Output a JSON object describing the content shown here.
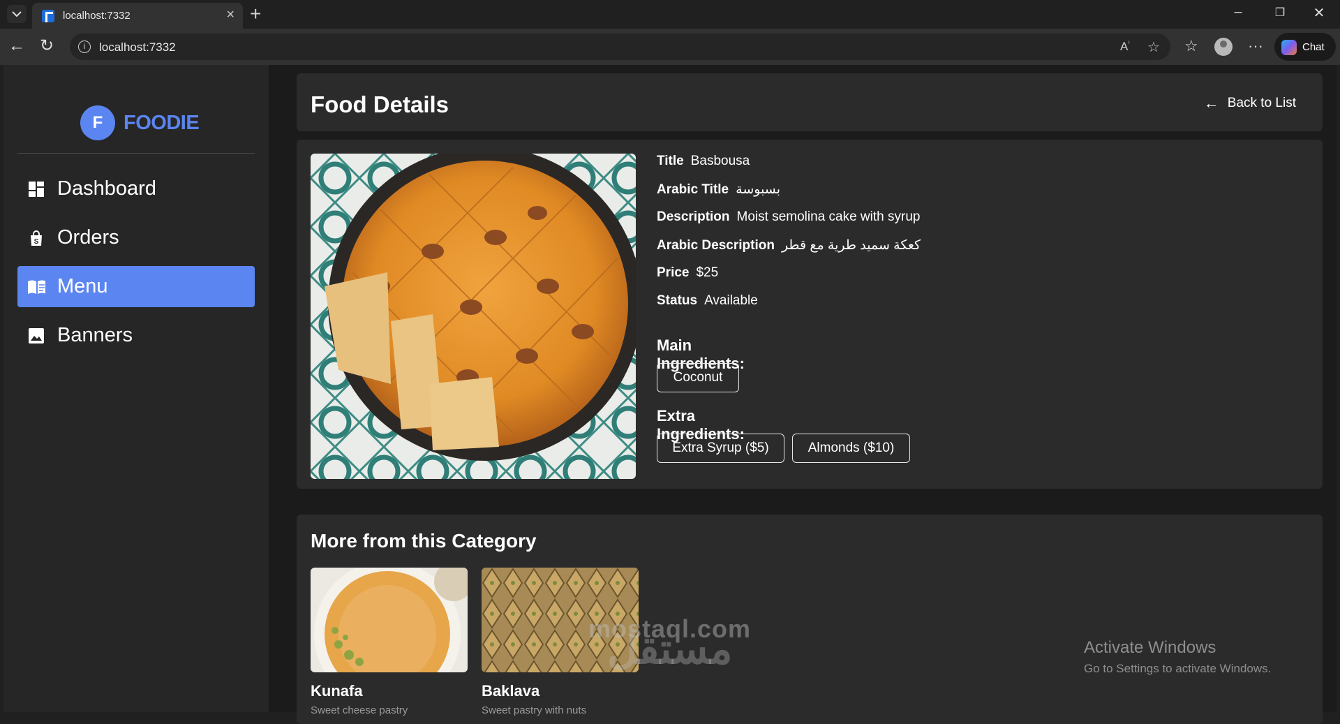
{
  "browser": {
    "tab_title": "localhost:7332",
    "url": "localhost:7332",
    "chat_label": "Chat"
  },
  "sidebar": {
    "logo_letter": "F",
    "logo_text": "FOODIE",
    "items": [
      {
        "label": "Dashboard",
        "icon": "dashboard-icon"
      },
      {
        "label": "Orders",
        "icon": "shopping-bag-icon"
      },
      {
        "label": "Menu",
        "icon": "menu-book-icon",
        "active": true
      },
      {
        "label": "Banners",
        "icon": "image-icon"
      }
    ],
    "accent_color": "#5b85f0"
  },
  "header": {
    "title": "Food Details",
    "back_label": "Back to List"
  },
  "food": {
    "fields": [
      {
        "key": "Title",
        "value": "Basbousa"
      },
      {
        "key": "Arabic Title",
        "value": "بسبوسة"
      },
      {
        "key": "Description",
        "value": "Moist semolina cake with syrup"
      },
      {
        "key": "Arabic Description",
        "value": "كعكة سميد طرية مع قطر"
      },
      {
        "key": "Price",
        "value": "$25"
      },
      {
        "key": "Status",
        "value": "Available"
      }
    ],
    "main_heading": "Main Ingredients:",
    "main_ingredients": [
      "Coconut"
    ],
    "extra_heading": "Extra Ingredients:",
    "extra_ingredients": [
      "Extra Syrup ($5)",
      "Almonds ($10)"
    ]
  },
  "more": {
    "title": "More from this Category",
    "items": [
      {
        "name": "Kunafa",
        "desc": "Sweet cheese pastry"
      },
      {
        "name": "Baklava",
        "desc": "Sweet pastry with nuts"
      }
    ]
  },
  "overlay": {
    "watermark": "mostaql.com",
    "watermark_ar": "مستقل",
    "activate_title": "Activate Windows",
    "activate_sub": "Go to Settings to activate Windows."
  }
}
